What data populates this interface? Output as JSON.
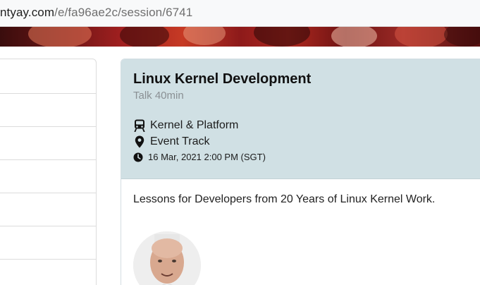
{
  "browser": {
    "url_host": "ntyay.com",
    "url_path": "/e/fa96ae2c/session/6741"
  },
  "sidebar": {
    "rows": [
      "",
      "",
      "",
      "",
      "",
      "",
      ""
    ]
  },
  "session": {
    "title": "Linux Kernel Development",
    "type": "Talk 40min",
    "track": "Kernel & Platform",
    "room": "Event Track",
    "datetime": "16 Mar, 2021 2:00 PM (SGT)",
    "summary": "Lessons for Developers from 20 Years of Linux Kernel Work.",
    "icons": {
      "track": "train-icon",
      "room": "map-marker-icon",
      "time": "clock-icon"
    }
  }
}
